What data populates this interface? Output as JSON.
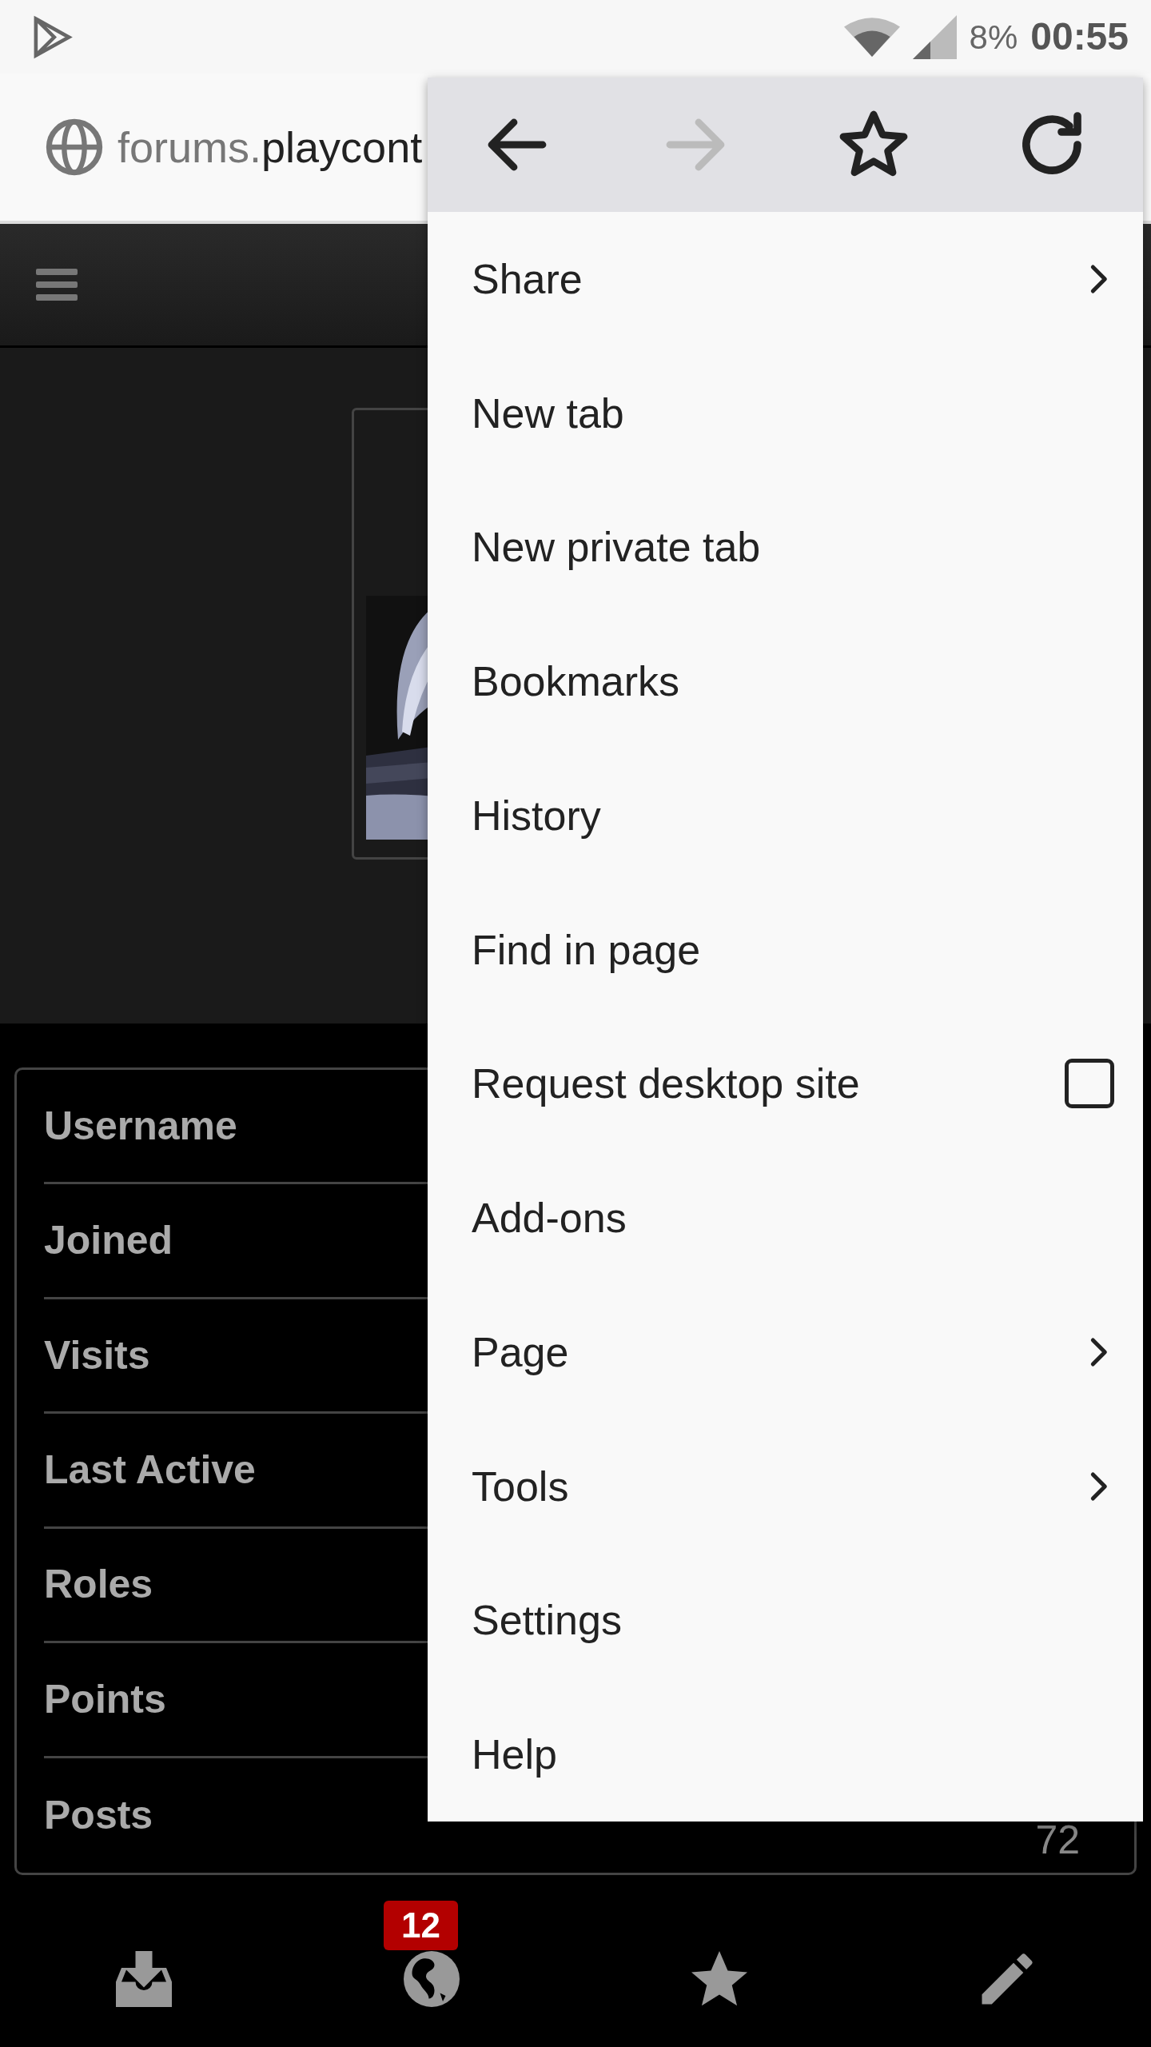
{
  "status_bar": {
    "battery": "8%",
    "time": "00:55"
  },
  "address_bar": {
    "subdomain": "forums.",
    "domain": "playcont"
  },
  "profile_rows": [
    {
      "label": "Username"
    },
    {
      "label": "Joined"
    },
    {
      "label": "Visits"
    },
    {
      "label": "Last Active"
    },
    {
      "label": "Roles"
    },
    {
      "label": "Points"
    },
    {
      "label": "Posts",
      "value": "72"
    }
  ],
  "menu": {
    "toolbar": [
      {
        "kind": "back",
        "disabled": false
      },
      {
        "kind": "forward",
        "disabled": true
      },
      {
        "kind": "bookmark",
        "disabled": false
      },
      {
        "kind": "reload",
        "disabled": false
      }
    ],
    "items": [
      {
        "label": "Share",
        "kind": "submenu"
      },
      {
        "label": "New tab",
        "kind": "plain"
      },
      {
        "label": "New private tab",
        "kind": "plain"
      },
      {
        "label": "Bookmarks",
        "kind": "plain"
      },
      {
        "label": "History",
        "kind": "plain"
      },
      {
        "label": "Find in page",
        "kind": "plain"
      },
      {
        "label": "Request desktop site",
        "kind": "checkbox",
        "checked": false
      },
      {
        "label": "Add-ons",
        "kind": "plain"
      },
      {
        "label": "Page",
        "kind": "submenu"
      },
      {
        "label": "Tools",
        "kind": "submenu"
      },
      {
        "label": "Settings",
        "kind": "plain"
      },
      {
        "label": "Help",
        "kind": "plain"
      }
    ]
  },
  "bottom_nav": [
    {
      "kind": "downloads"
    },
    {
      "kind": "globe",
      "badge": "12"
    },
    {
      "kind": "star"
    },
    {
      "kind": "edit"
    }
  ]
}
